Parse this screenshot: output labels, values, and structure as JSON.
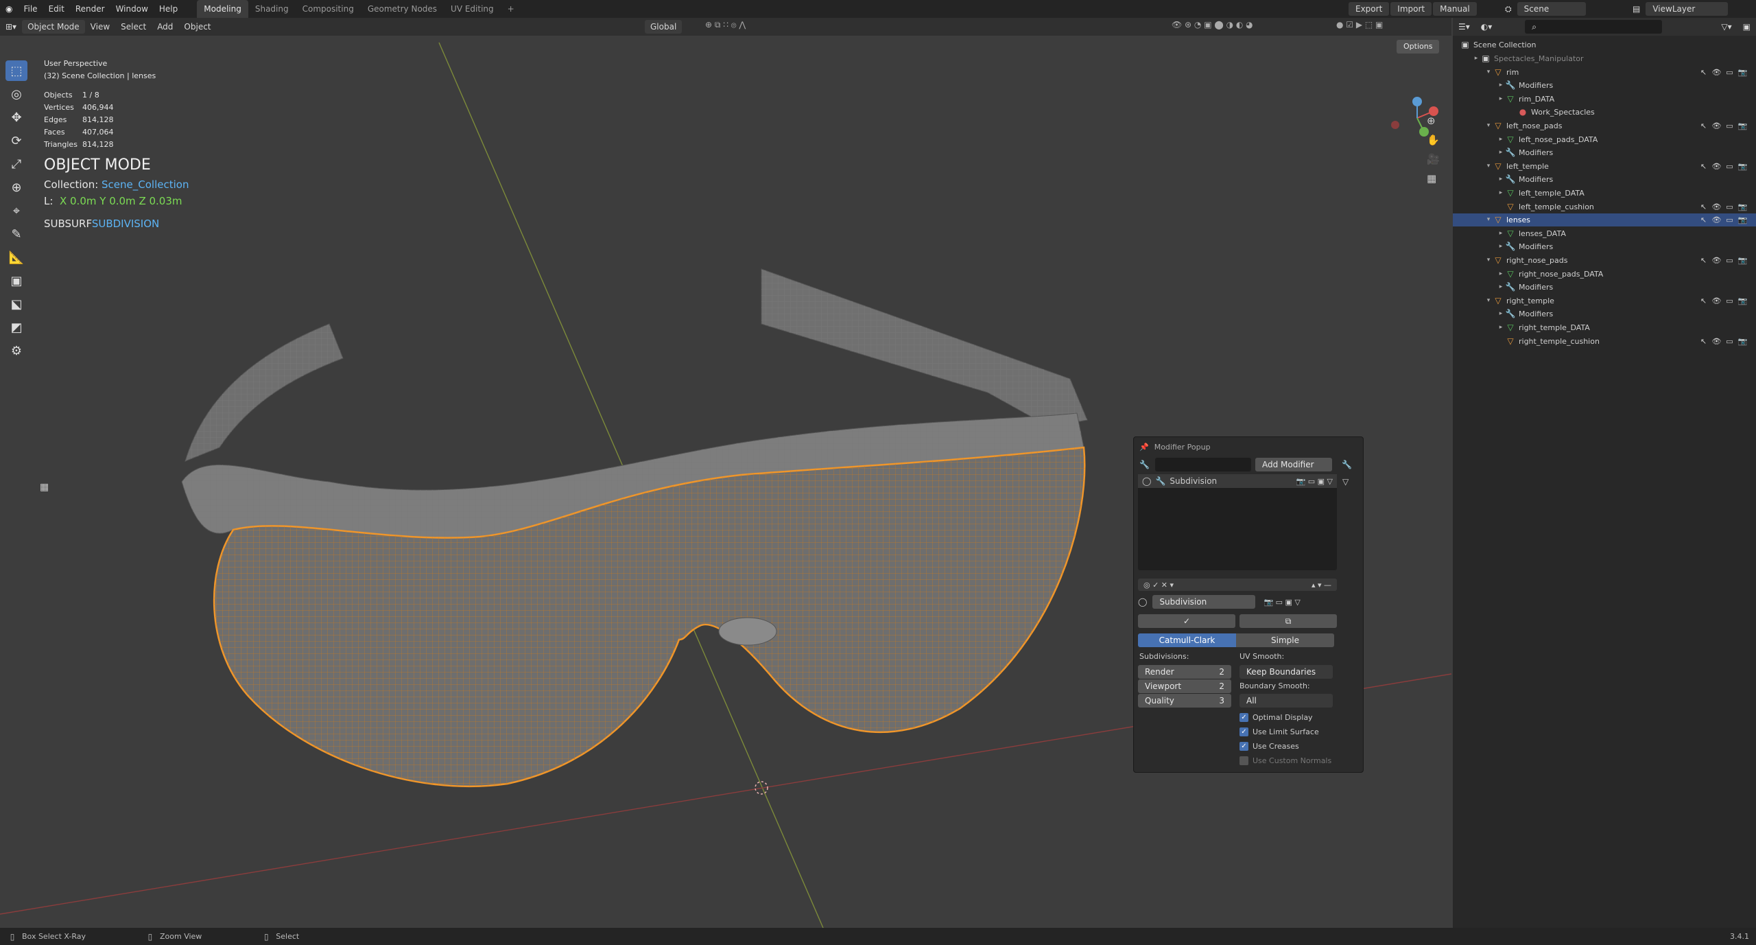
{
  "menubar": {
    "items": [
      "File",
      "Edit",
      "Render",
      "Window",
      "Help"
    ],
    "workspaces": [
      "Modeling",
      "Shading",
      "Compositing",
      "Geometry Nodes",
      "UV Editing"
    ],
    "add_tab": "+",
    "right": {
      "export": "Export",
      "import": "Import",
      "manual": "Manual",
      "scene": "Scene",
      "view_layer": "ViewLayer"
    }
  },
  "viewport_header": {
    "mode": "Object Mode",
    "menus": [
      "View",
      "Select",
      "Add",
      "Object"
    ],
    "orientation": "Global",
    "options": "Options"
  },
  "overlay": {
    "perspective": "User Perspective",
    "collection_path": "(32) Scene Collection | lenses",
    "stats": [
      {
        "k": "Objects",
        "v": "1 / 8"
      },
      {
        "k": "Vertices",
        "v": "406,944"
      },
      {
        "k": "Edges",
        "v": "814,128"
      },
      {
        "k": "Faces",
        "v": "407,064"
      },
      {
        "k": "Triangles",
        "v": "814,128"
      }
    ],
    "mode_title": "OBJECT MODE",
    "collection_label": "Collection: ",
    "collection_name": "Scene_Collection",
    "loc_label": "L:",
    "loc_x": "X 0.0m",
    "loc_y": "Y 0.0m",
    "loc_z": "Z 0.03m",
    "op_prefix": "SUBSURF",
    "op_suffix": "SUBDIVISION"
  },
  "popup": {
    "title": "Modifier Popup",
    "add_modifier": "Add Modifier",
    "list_item": "Subdivision",
    "name_field": "Subdivision",
    "mode_a": "Catmull-Clark",
    "mode_b": "Simple",
    "subdivisions_label": "Subdivisions:",
    "render_label": "Render",
    "render_value": "2",
    "viewport_label": "Viewport",
    "viewport_value": "2",
    "quality_label": "Quality",
    "quality_value": "3",
    "uv_smooth_label": "UV Smooth:",
    "uv_smooth_value": "Keep Boundaries",
    "boundary_smooth_label": "Boundary Smooth:",
    "boundary_smooth_value": "All",
    "checks": [
      {
        "label": "Optimal Display",
        "on": true
      },
      {
        "label": "Use Limit Surface",
        "on": true
      },
      {
        "label": "Use Creases",
        "on": true
      },
      {
        "label": "Use Custom Normals",
        "on": false
      }
    ]
  },
  "outliner": {
    "root": "Scene Collection",
    "rows": [
      {
        "label": "Spectacles_Manipulator",
        "depth": 1,
        "icon": "collection-icon",
        "dim": true
      },
      {
        "label": "rim",
        "depth": 2,
        "icon": "mesh-object-icon"
      },
      {
        "label": "Modifiers",
        "depth": 3,
        "icon": "wrench-icon"
      },
      {
        "label": "rim_DATA",
        "depth": 3,
        "icon": "mesh-data-icon"
      },
      {
        "label": "Work_Spectacles",
        "depth": 4,
        "icon": "material-icon"
      },
      {
        "label": "left_nose_pads",
        "depth": 2,
        "icon": "mesh-object-icon"
      },
      {
        "label": "left_nose_pads_DATA",
        "depth": 3,
        "icon": "mesh-data-icon"
      },
      {
        "label": "Modifiers",
        "depth": 3,
        "icon": "wrench-icon"
      },
      {
        "label": "left_temple",
        "depth": 2,
        "icon": "mesh-object-icon"
      },
      {
        "label": "Modifiers",
        "depth": 3,
        "icon": "wrench-icon"
      },
      {
        "label": "left_temple_DATA",
        "depth": 3,
        "icon": "mesh-data-icon"
      },
      {
        "label": "left_temple_cushion",
        "depth": 3,
        "icon": "mesh-object-icon"
      },
      {
        "label": "lenses",
        "depth": 2,
        "icon": "mesh-object-icon",
        "selected": true
      },
      {
        "label": "lenses_DATA",
        "depth": 3,
        "icon": "mesh-data-icon"
      },
      {
        "label": "Modifiers",
        "depth": 3,
        "icon": "wrench-icon"
      },
      {
        "label": "right_nose_pads",
        "depth": 2,
        "icon": "mesh-object-icon"
      },
      {
        "label": "right_nose_pads_DATA",
        "depth": 3,
        "icon": "mesh-data-icon"
      },
      {
        "label": "Modifiers",
        "depth": 3,
        "icon": "wrench-icon"
      },
      {
        "label": "right_temple",
        "depth": 2,
        "icon": "mesh-object-icon"
      },
      {
        "label": "Modifiers",
        "depth": 3,
        "icon": "wrench-icon"
      },
      {
        "label": "right_temple_DATA",
        "depth": 3,
        "icon": "mesh-data-icon"
      },
      {
        "label": "right_temple_cushion",
        "depth": 3,
        "icon": "mesh-object-icon"
      }
    ]
  },
  "statusbar": {
    "items": [
      "Box Select X-Ray",
      "Zoom View",
      "Select"
    ],
    "version": "3.4.1"
  },
  "colors": {
    "accent": "#4772b3",
    "selection_orange": "#f0962a",
    "wire": "#8c8c8c"
  }
}
